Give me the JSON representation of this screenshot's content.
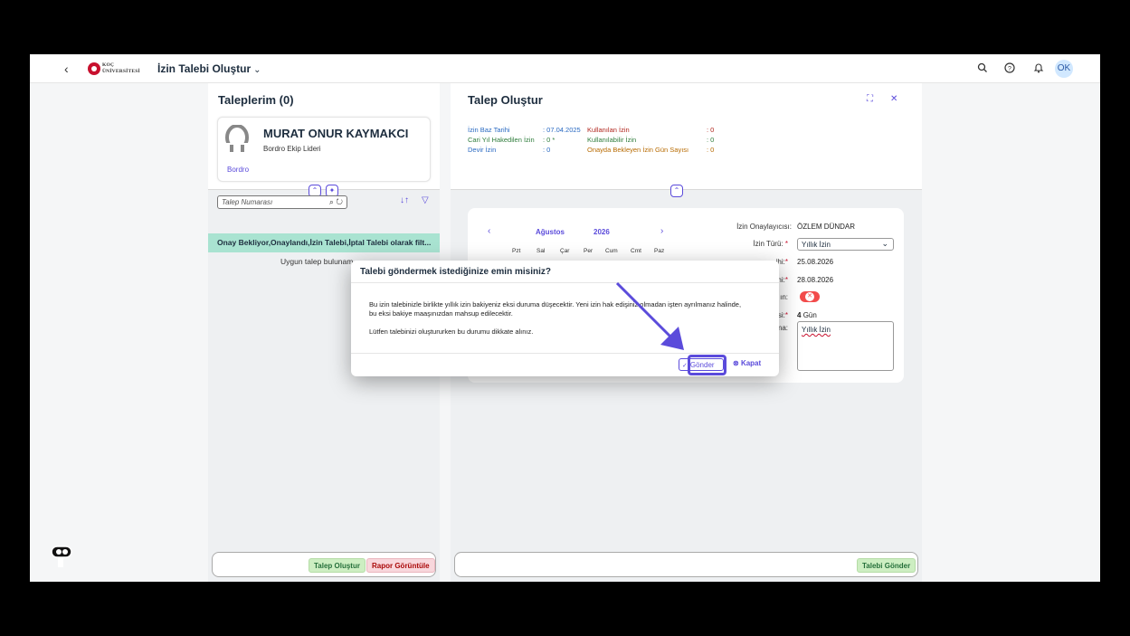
{
  "shell": {
    "logo_top": "KOÇ",
    "logo_bottom": "ÜNİVERSİTESİ",
    "title": "İzin Talebi Oluştur",
    "avatar": "OK"
  },
  "left": {
    "title": "Taleplerim (0)",
    "employee_name": "MURAT ONUR KAYMAKCI",
    "employee_role": "Bordro Ekip Lideri",
    "department": "Bordro",
    "search_placeholder": "Talep Numarası",
    "filter_info": "Onay Bekliyor,Onaylandı,İzin Talebi,İptal Talebi olarak filt...",
    "no_data": "Uygun talep bulunam",
    "create_btn": "Talep Oluştur",
    "report_btn": "Rapor Görüntüle"
  },
  "right": {
    "title": "Talep Oluştur",
    "summary": {
      "base_date_label": "İzin Baz Tarihi",
      "base_date_value": ": 07.04.2025",
      "earned_label": "Cari Yıl Hakedilen İzin",
      "earned_value": ": 0 *",
      "carry_label": "Devir İzin",
      "carry_value": ": 0",
      "used_label": "Kullanılan İzin",
      "used_value": ": 0",
      "available_label": "Kullanılabilir İzin",
      "available_value": ": 0",
      "pending_label": "Onayda Bekleyen İzin Gün Sayısı",
      "pending_value": ": 0"
    },
    "calendar": {
      "month": "Ağustos",
      "year": "2026",
      "days": [
        "Pzt",
        "Sal",
        "Çar",
        "Per",
        "Cum",
        "Cmt",
        "Paz"
      ]
    },
    "form": {
      "approver_label": "İzin Onaylayıcısı:",
      "approver_value": "ÖZLEM DÜNDAR",
      "type_label": "İzin Türü:",
      "type_value": "Yıllık İzin",
      "start_label": "ihi:",
      "start_value": "25.08.2026",
      "end_label": "ihi:",
      "end_value": "28.08.2026",
      "halfday_label": "ın:",
      "duration_label": "esi:",
      "duration_value": "4",
      "duration_unit": "Gün",
      "note_label": "ma:",
      "note_value": "Yıllık İzin"
    },
    "send_btn": "Talebi Gönder"
  },
  "dialog": {
    "title": "Talebi göndermek istediğinize emin misiniz?",
    "message": "Bu izin talebinizle birlikte yıllık izin bakiyeniz eksi duruma düşecektir. Yeni izin hak edişiniz olmadan işten ayrılmanız halinde, bu eksi bakiye maaşınızdan mahsup edilecektir.",
    "note": "Lütfen talebinizi oluştururken bu durumu dikkate alınız.",
    "send": "Gönder",
    "close": "Kapat"
  },
  "colors": {
    "accent": "#5b4bdb",
    "filter_bar": "#a9e3d1"
  }
}
